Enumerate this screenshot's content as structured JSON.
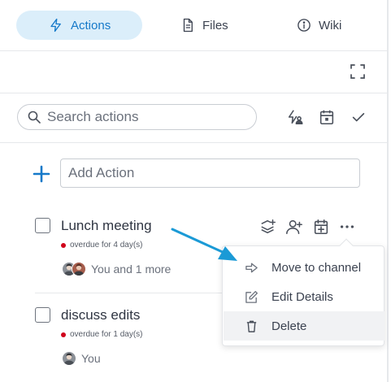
{
  "tabs": [
    {
      "label": "Actions",
      "icon": "lightning-icon",
      "active": true
    },
    {
      "label": "Files",
      "icon": "file-icon",
      "active": false
    },
    {
      "label": "Wiki",
      "icon": "info-icon",
      "active": false
    }
  ],
  "search": {
    "placeholder": "Search actions"
  },
  "add_action": {
    "placeholder": "Add Action"
  },
  "actions": [
    {
      "title": "Lunch meeting",
      "overdue": "overdue for 4 day(s)",
      "assignee": "You and 1 more"
    },
    {
      "title": "discuss edits",
      "overdue": "overdue for 1 day(s)",
      "assignee": "You"
    }
  ],
  "menu": {
    "items": [
      {
        "label": "Move to channel",
        "icon": "arrow-right-icon"
      },
      {
        "label": "Edit Details",
        "icon": "edit-icon"
      },
      {
        "label": "Delete",
        "icon": "trash-icon"
      }
    ]
  },
  "colors": {
    "accent": "#1579c9",
    "active_tab_bg": "#dbeefa",
    "overdue_dot": "#d0021b",
    "annotation_arrow": "#1b9ad6"
  }
}
